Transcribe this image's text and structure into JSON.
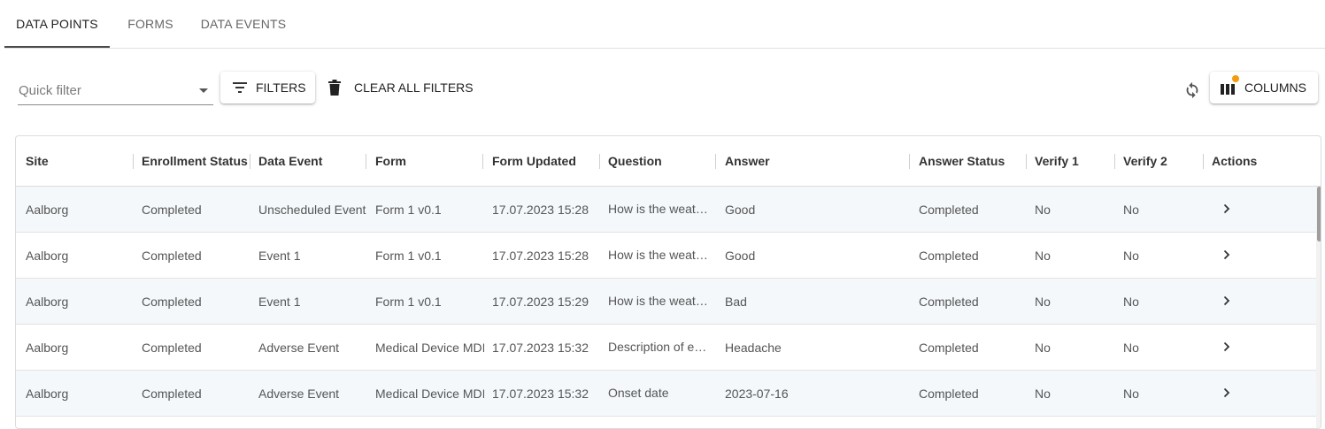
{
  "tabs": [
    {
      "label": "DATA POINTS",
      "active": true
    },
    {
      "label": "FORMS",
      "active": false
    },
    {
      "label": "DATA EVENTS",
      "active": false
    }
  ],
  "toolbar": {
    "quick_filter_placeholder": "Quick filter",
    "filters_label": "FILTERS",
    "clear_label": "CLEAR ALL FILTERS",
    "columns_label": "COLUMNS",
    "columns_badge_color": "#f39c12"
  },
  "table": {
    "columns": [
      "Site",
      "Enrollment Status",
      "Data Event",
      "Form",
      "Form Updated",
      "Question",
      "Answer",
      "Answer Status",
      "Verify 1",
      "Verify 2",
      "Actions"
    ],
    "rows": [
      [
        "Aalborg",
        "Completed",
        "Unscheduled Event",
        "Form 1 v0.1",
        "17.07.2023 15:28",
        "How is the weather today?",
        "Good",
        "Completed",
        "No",
        "No"
      ],
      [
        "Aalborg",
        "Completed",
        "Event 1",
        "Form 1 v0.1",
        "17.07.2023 15:28",
        "How is the weather today?",
        "Good",
        "Completed",
        "No",
        "No"
      ],
      [
        "Aalborg",
        "Completed",
        "Event 1",
        "Form 1 v0.1",
        "17.07.2023 15:29",
        "How is the weather today?",
        "Bad",
        "Completed",
        "No",
        "No"
      ],
      [
        "Aalborg",
        "Completed",
        "Adverse Event",
        "Medical Device MDI",
        "17.07.2023 15:32",
        "Description of event",
        "Headache",
        "Completed",
        "No",
        "No"
      ],
      [
        "Aalborg",
        "Completed",
        "Adverse Event",
        "Medical Device MDI",
        "17.07.2023 15:32",
        "Onset date",
        "2023-07-16",
        "Completed",
        "No",
        "No"
      ]
    ]
  }
}
